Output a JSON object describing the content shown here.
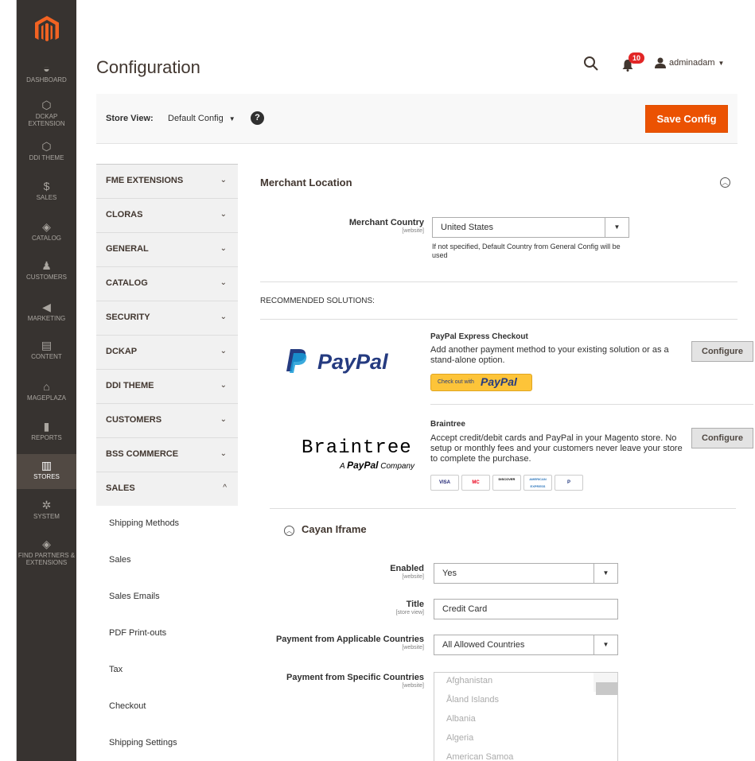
{
  "nav": {
    "items": [
      {
        "label": "DASHBOARD",
        "icon": "dashboard-icon"
      },
      {
        "label": "DCKAP EXTENSION",
        "icon": "hexagon-icon"
      },
      {
        "label": "DDI THEME",
        "icon": "hexagon-icon"
      },
      {
        "label": "SALES",
        "icon": "dollar-icon"
      },
      {
        "label": "CATALOG",
        "icon": "box-icon"
      },
      {
        "label": "CUSTOMERS",
        "icon": "person-icon"
      },
      {
        "label": "MARKETING",
        "icon": "megaphone-icon"
      },
      {
        "label": "CONTENT",
        "icon": "layout-icon"
      },
      {
        "label": "MAGEPLAZA",
        "icon": "mageplaza-icon"
      },
      {
        "label": "REPORTS",
        "icon": "bar-chart-icon"
      },
      {
        "label": "STORES",
        "icon": "store-icon"
      },
      {
        "label": "SYSTEM",
        "icon": "gear-icon"
      },
      {
        "label": "FIND PARTNERS & EXTENSIONS",
        "icon": "box-icon"
      }
    ]
  },
  "header": {
    "title": "Configuration",
    "notifications": "10",
    "user": "adminadam"
  },
  "store_bar": {
    "label": "Store View:",
    "value": "Default Config",
    "help": "?",
    "save": "Save Config"
  },
  "tabs": [
    {
      "label": "FME EXTENSIONS",
      "chev": "⌄"
    },
    {
      "label": "CLORAS",
      "chev": "⌄"
    },
    {
      "label": "GENERAL",
      "chev": "⌄"
    },
    {
      "label": "CATALOG",
      "chev": "⌄"
    },
    {
      "label": "SECURITY",
      "chev": "⌄"
    },
    {
      "label": "DCKAP",
      "chev": "⌄"
    },
    {
      "label": "DDI THEME",
      "chev": "⌄"
    },
    {
      "label": "CUSTOMERS",
      "chev": "⌄"
    },
    {
      "label": "BSS COMMERCE",
      "chev": "⌄"
    },
    {
      "label": "SALES",
      "chev": "^"
    }
  ],
  "sales_subs": [
    "Shipping Methods",
    "Sales",
    "Sales Emails",
    "PDF Print-outs",
    "Tax",
    "Checkout",
    "Shipping Settings"
  ],
  "merchant": {
    "title": "Merchant Location",
    "country_label": "Merchant Country",
    "country_scope": "[website]",
    "country_value": "United States",
    "note": "If not specified, Default Country from General Config will be used"
  },
  "recommended": {
    "title": "RECOMMENDED SOLUTIONS:",
    "paypal": {
      "logo": "PayPal",
      "title": "PayPal Express Checkout",
      "desc": "Add another payment method to your existing solution or as a stand-alone option.",
      "btn_text": "Check out with",
      "btn_brand": "PayPal",
      "configure": "Configure"
    },
    "braintree": {
      "logo": "Braintree",
      "tagline_a": "A",
      "tagline_brand": "PayPal",
      "tagline_b": "Company",
      "title": "Braintree",
      "desc": "Accept credit/debit cards and PayPal in your Magento store. No setup or monthly fees and your customers never leave your store to complete the purchase.",
      "cards": [
        "VISA",
        "MC",
        "DISCOVER",
        "AMERICAN EXPRESS",
        "P"
      ],
      "configure": "Configure"
    }
  },
  "cayan": {
    "title": "Cayan Iframe",
    "enabled_label": "Enabled",
    "enabled_scope": "[website]",
    "enabled_value": "Yes",
    "title_label": "Title",
    "title_scope": "[store view]",
    "title_value": "Credit Card",
    "applicable_label": "Payment from Applicable Countries",
    "applicable_scope": "[website]",
    "applicable_value": "All Allowed Countries",
    "specific_label": "Payment from Specific Countries",
    "specific_scope": "[website]",
    "countries": [
      "Afghanistan",
      "Åland Islands",
      "Albania",
      "Algeria",
      "American Samoa"
    ]
  }
}
